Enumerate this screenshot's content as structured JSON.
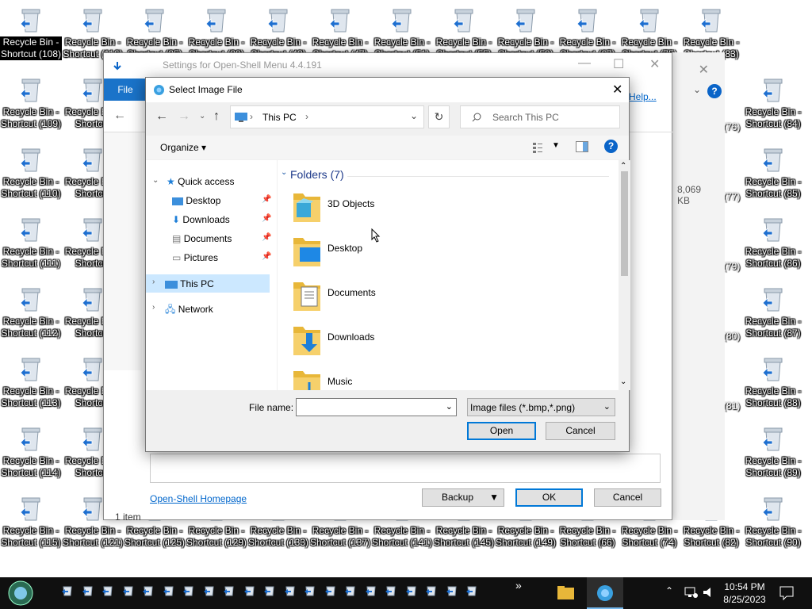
{
  "desktop": {
    "columns": [
      [
        "Recycle Bin -\nShortcut (108)",
        "Recycle Bin -\nShortcut (109)",
        "Recycle Bin -\nShortcut (110)",
        "Recycle Bin -\nShortcut (111)",
        "Recycle Bin -\nShortcut (112)",
        "Recycle Bin -\nShortcut (113)",
        "Recycle Bin -\nShortcut (114)",
        "Recycle Bin -\nShortcut (115)"
      ],
      [
        "Recycle Bin -\nShortcut (116)",
        "Recycle Bin -\nShortcut",
        "Recycle Bin -\nShortcut",
        "Recycle Bin -\nShortcut",
        "Recycle Bin -\nShortcut",
        "Recycle Bin -\nShortcut",
        "Recycle Bin -\nShortcut",
        "Recycle Bin -\nShortcut (121)"
      ]
    ],
    "top_row": [
      "Shortcut (35)",
      "Shortcut (39)",
      "Shortcut (43)",
      "Shortcut (47)",
      "Shortcut (51)",
      "Shortcut (55)",
      "Shortcut (59)",
      "Shortcut (67)",
      "Shortcut (75)",
      "Shortcut (83)"
    ],
    "bottom_row": [
      "Shortcut (125)",
      "Shortcut (129)",
      "Shortcut (133)",
      "Shortcut (137)",
      "Shortcut (141)",
      "Shortcut (145)",
      "Shortcut (149)",
      "Shortcut (66)",
      "Shortcut (74)",
      "Shortcut (82)",
      "Shortcut (90)"
    ],
    "right_col": [
      "Shortcut (84)",
      "Shortcut (85)",
      "Shortcut (86)",
      "Shortcut (87)",
      "Shortcut (88)",
      "Shortcut (89)"
    ],
    "right_partial": [
      "(76)",
      "(77)",
      "(79)",
      "(80)",
      "(81)"
    ],
    "icon_label_prefix": "Recycle Bin -"
  },
  "settings_window": {
    "title": "Settings for Open-Shell Menu 4.4.191",
    "file_tab": "File",
    "help_link": "Help...",
    "size_text": "8,069 KB",
    "homepage_link": "Open-Shell Homepage",
    "backup_label": "Backup",
    "ok_label": "OK",
    "cancel_label": "Cancel",
    "status_text": "1 item"
  },
  "dialog": {
    "title": "Select Image File",
    "close": "✕",
    "address": {
      "root": "This PC",
      "sep": "›"
    },
    "search_placeholder": "Search This PC",
    "organize_label": "Organize",
    "nav": {
      "quick_access": "Quick access",
      "desktop": "Desktop",
      "downloads": "Downloads",
      "documents": "Documents",
      "pictures": "Pictures",
      "this_pc": "This PC",
      "network": "Network"
    },
    "group_header": "Folders (7)",
    "folders": [
      "3D Objects",
      "Desktop",
      "Documents",
      "Downloads",
      "Music"
    ],
    "file_name_label": "File name:",
    "file_name_value": "",
    "filter_value": "Image files (*.bmp,*.png)",
    "open_label": "Open",
    "cancel_label": "Cancel"
  },
  "taskbar": {
    "time": "10:54 PM",
    "date": "8/25/2023",
    "overflow": "»"
  },
  "colors": {
    "accent": "#0078d7",
    "selection": "#cce8ff",
    "taskbar": "#101010"
  }
}
